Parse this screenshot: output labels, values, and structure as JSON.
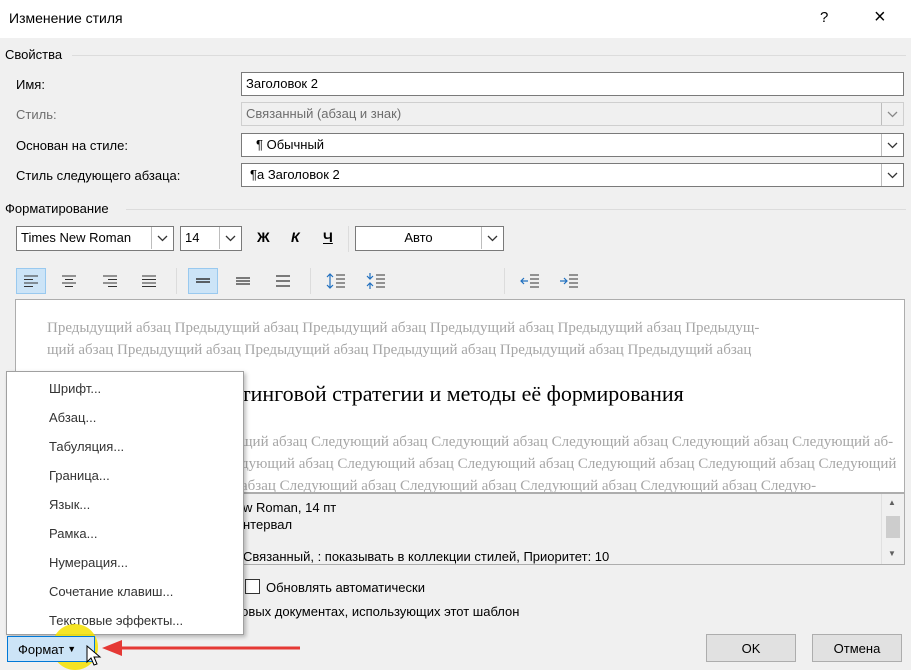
{
  "window": {
    "title": "Изменение стиля",
    "help": "?",
    "close": "×"
  },
  "properties": {
    "section": "Свойства",
    "name_label": "Имя:",
    "name_value": "Заголовок 2",
    "style_type_label": "Стиль:",
    "style_type_value": "Связанный (абзац и знак)",
    "based_on_label": "Основан на стиле:",
    "based_on_value": "¶  Обычный",
    "next_style_label": "Стиль следующего абзаца:",
    "next_style_value": "¶a  Заголовок 2"
  },
  "formatting": {
    "section": "Форматирование",
    "font": "Times New Roman",
    "size": "14",
    "bold": "Ж",
    "italic": "К",
    "underline": "Ч",
    "color": "Авто"
  },
  "preview": {
    "previous_line1": "Предыдущий абзац Предыдущий абзац Предыдущий абзац Предыдущий абзац Предыдущий абзац Предыдущ-",
    "previous_line2": "щий абзац Предыдущий абзац Предыдущий абзац Предыдущий абзац Предыдущий абзац Предыдущий абзац",
    "sample": "тинговой стратегии и методы её формирования",
    "next_line1": "щий абзац Следующий абзац Следующий абзац Следующий абзац Следующий абзац Следующий аб-",
    "next_line2": "дующий абзац Следующий абзац Следующий абзац Следующий абзац Следующий абзац Следующий",
    "next_line3": "абзац Следующий абзац Следующий абзац Следующий абзац Следующий абзац Следую-"
  },
  "description": {
    "line1": "w Roman, 14 пт",
    "line2": "нтервал",
    "line3": "Связанный, : показывать в коллекции стилей, Приоритет: 10"
  },
  "options": {
    "auto_update": "Обновлять автоматически",
    "new_docs": "новых документах, использующих этот шаблон"
  },
  "format_menu": {
    "items": [
      "Шрифт...",
      "Абзац...",
      "Табуляция...",
      "Граница...",
      "Язык...",
      "Рамка...",
      "Нумерация...",
      "Сочетание клавиш...",
      "Текстовые эффекты..."
    ]
  },
  "buttons": {
    "format": "Формат",
    "ok": "OK",
    "cancel": "Отмена"
  },
  "colors": {
    "accent": "#0078d7",
    "arrow": "#e53935",
    "highlight": "#f5e100"
  }
}
